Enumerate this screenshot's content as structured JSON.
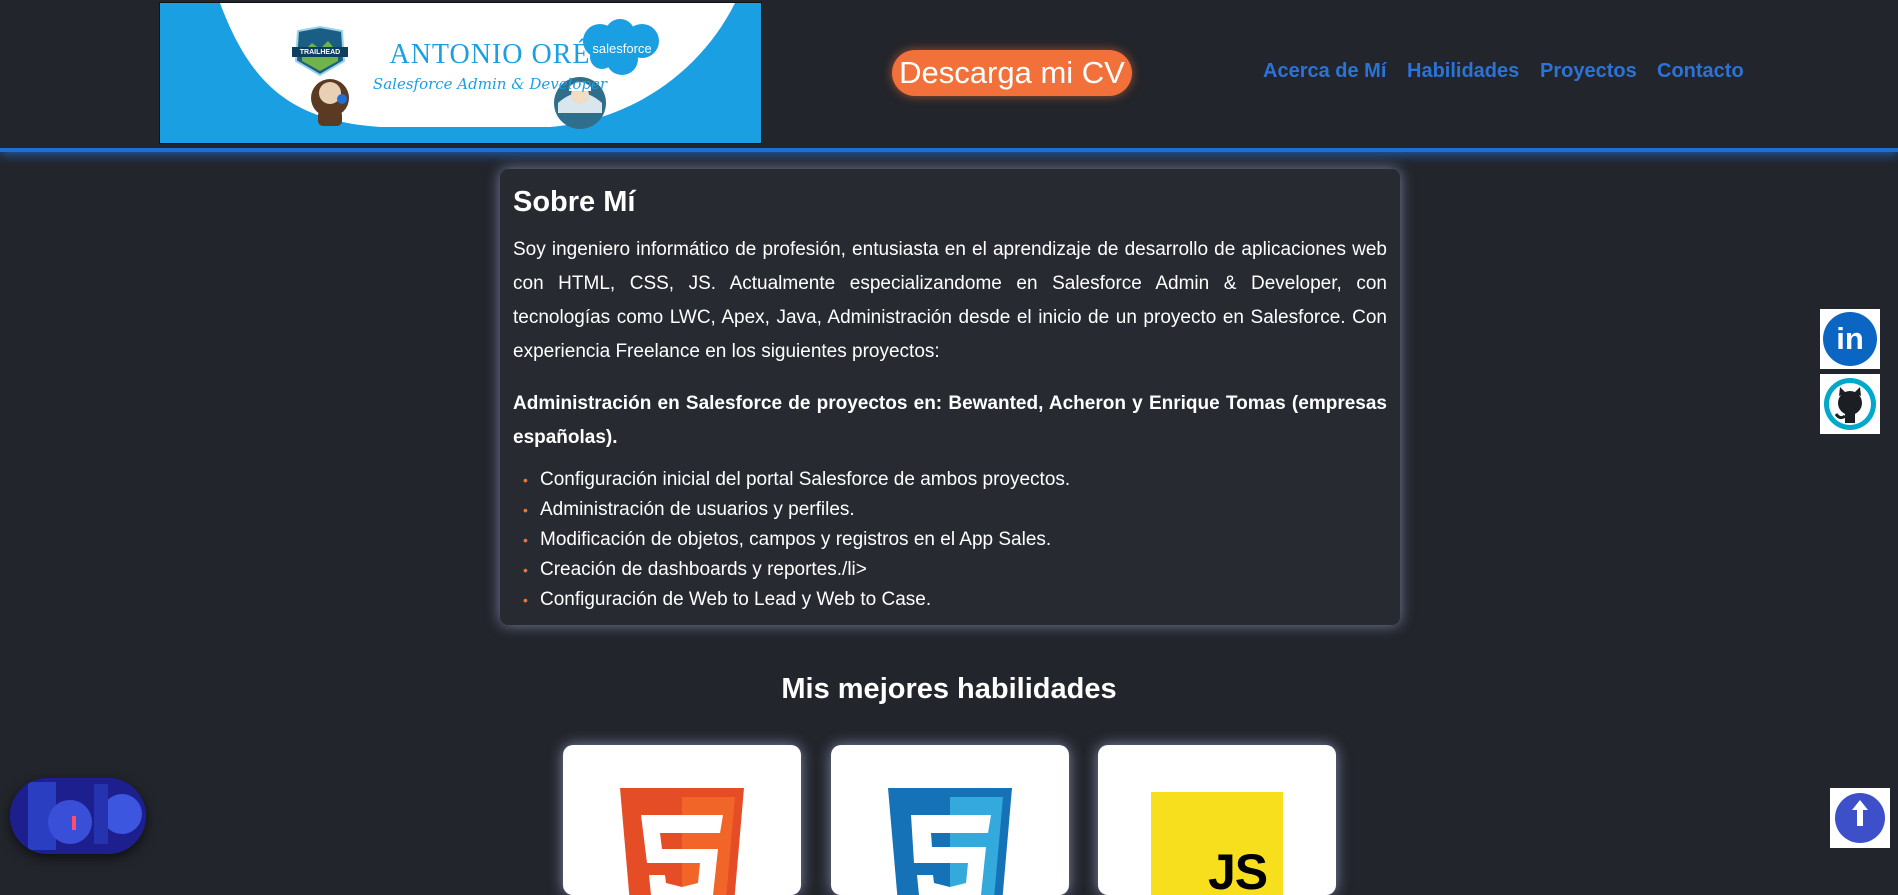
{
  "header": {
    "banner": {
      "name": "ANTONIO ORÉ",
      "subtitle": "Salesforce Admin & Developer",
      "trailhead_badge": "TRAILHEAD",
      "salesforce_logo": "salesforce"
    },
    "cv_button": "Descarga mi CV",
    "nav": [
      "Acerca de Mí",
      "Habilidades",
      "Proyectos",
      "Contacto"
    ]
  },
  "about": {
    "title": "Sobre Mí",
    "intro": "Soy ingeniero informático de profesión, entusiasta en el aprendizaje de desarrollo de aplicaciones web con HTML, CSS, JS. Actualmente especializandome en Salesforce Admin & Developer, con tecnologías como LWC, Apex, Java, Administración desde el inicio de un proyecto en Salesforce. Con experiencia Freelance en los siguientes proyectos:",
    "project_heading": "Administración en Salesforce de proyectos en: Bewanted, Acheron y Enrique Tomas (empresas españolas).",
    "tasks": [
      "Configuración inicial del portal Salesforce de ambos proyectos.",
      "Administración de usuarios y perfiles.",
      "Modificación de objetos, campos y registros en el App Sales.",
      "Creación de dashboards y reportes./li>",
      "Configuración de Web to Lead y Web to Case."
    ],
    "bullet": "•"
  },
  "skills": {
    "title": "Mis mejores habilidades",
    "items": [
      {
        "icon": "html5-icon",
        "color": "#e44d26",
        "digit": "5"
      },
      {
        "icon": "css3-icon",
        "color": "#1572b6",
        "digit": "3"
      },
      {
        "icon": "javascript-icon",
        "color": "#f7df1e",
        "text": "JS"
      }
    ]
  },
  "social": {
    "linkedin": {
      "icon": "linkedin-icon",
      "text": "in",
      "color": "#0a66c2"
    },
    "github": {
      "icon": "github-icon",
      "color": "#00a9c9"
    }
  },
  "colors": {
    "background": "#22252b",
    "accent": "#f2713a",
    "nav": "#2b73d6",
    "header_border": "#1f6fd6"
  }
}
